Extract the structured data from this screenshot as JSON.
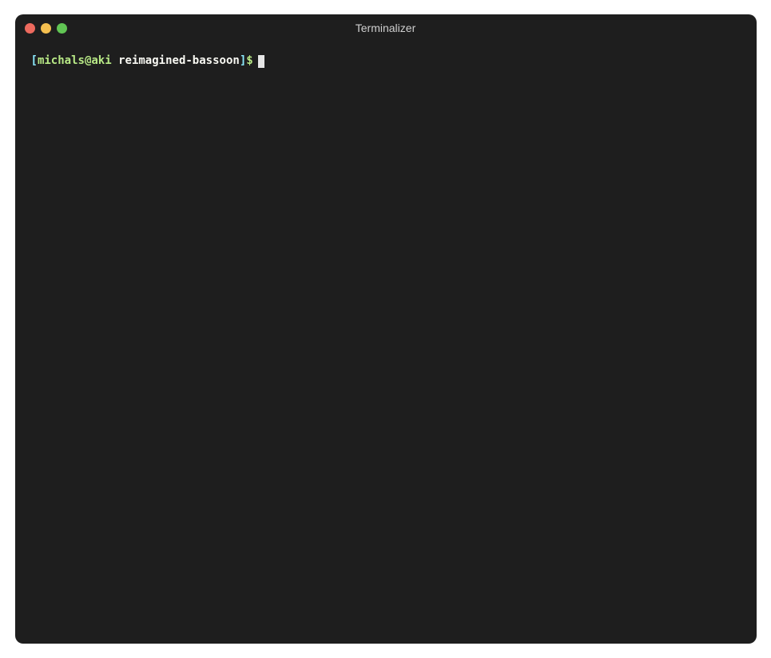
{
  "window": {
    "title": "Terminalizer"
  },
  "prompt": {
    "open_bracket": "[",
    "user_host": "michals@aki",
    "cwd": "reimagined-bassoon",
    "close_bracket": "]",
    "symbol": "$"
  },
  "colors": {
    "background": "#1e1e1e",
    "red": "#ed6a5e",
    "yellow": "#f5bf4f",
    "green": "#61c554",
    "bracket": "#8be9fd",
    "user_host": "#b8e986",
    "cwd": "#f8f8f2",
    "cursor": "#e6e6e6"
  }
}
